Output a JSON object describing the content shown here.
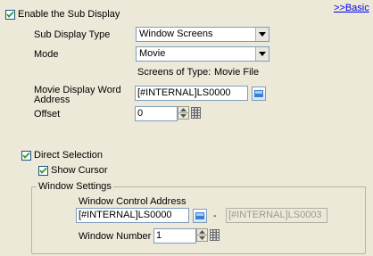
{
  "basic_link": ">>Basic",
  "enable_sub_display": {
    "label": "Enable the Sub Display",
    "checked": true
  },
  "sub_display_type": {
    "label": "Sub Display Type",
    "value": "Window Screens"
  },
  "mode": {
    "label": "Mode",
    "value": "Movie"
  },
  "screens_of_type": {
    "label": "Screens of Type:",
    "value": "Movie File"
  },
  "movie_display_word_address": {
    "label_line1": "Movie Display Word",
    "label_line2": "Address",
    "value": "[#INTERNAL]LS0000"
  },
  "offset": {
    "label": "Offset",
    "value": "0"
  },
  "direct_selection": {
    "label": "Direct Selection",
    "checked": true
  },
  "show_cursor": {
    "label": "Show Cursor",
    "checked": true
  },
  "window_settings": {
    "title": "Window Settings",
    "control_address_label": "Window Control Address",
    "control_address_value": "[#INTERNAL]LS0000",
    "range_separator": "-",
    "control_address_end": "[#INTERNAL]LS0003",
    "window_number_label": "Window Number",
    "window_number_value": "1"
  },
  "icons": {
    "checkbox": "checkmark-icon",
    "dropdown": "chevron-down-icon",
    "address_picker": "address-input-icon",
    "spinner": "spin-arrows-icon",
    "keypad": "keypad-icon"
  },
  "colors": {
    "background": "#ece9d8",
    "link": "#0000ee",
    "field_border": "#7f9db9"
  }
}
